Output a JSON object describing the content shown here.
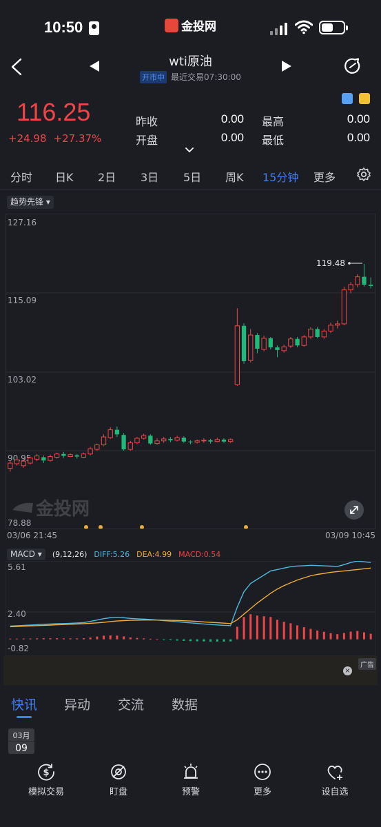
{
  "status_bar": {
    "time": "10:50",
    "logo_text": "金投网"
  },
  "header": {
    "title": "wti原油",
    "market_status": "开市中",
    "last_trade": "最近交易07:30:00"
  },
  "quote": {
    "price": "116.25",
    "change": "+24.98",
    "change_pct": "+27.37%",
    "prev_close_label": "昨收",
    "prev_close": "0.00",
    "high_label": "最高",
    "high": "0.00",
    "open_label": "开盘",
    "open": "0.00",
    "low_label": "最低",
    "low": "0.00",
    "up_color": "#ef4548",
    "down_color": "#1fb97a"
  },
  "period_tabs": [
    {
      "label": "分时"
    },
    {
      "label": "日K"
    },
    {
      "label": "2日"
    },
    {
      "label": "3日"
    },
    {
      "label": "5日"
    },
    {
      "label": "周K"
    },
    {
      "label": "15分钟",
      "active": true
    },
    {
      "label": "更多"
    }
  ],
  "indicator_select": "趋势先锋",
  "chart_data": {
    "type": "candlestick",
    "y_ticks": [
      "127.16",
      "115.09",
      "103.02",
      "90.95",
      "78.88"
    ],
    "ylim": [
      78.88,
      127.16
    ],
    "x_start_label": "03/06 21:45",
    "x_end_label": "03/09 10:45",
    "max_marker": "119.48",
    "watermark": "金投网",
    "candles": [
      [
        88.2,
        89.0,
        87.7,
        89.4
      ],
      [
        88.9,
        89.5,
        88.6,
        89.8
      ],
      [
        88.6,
        89.3,
        88.3,
        89.6
      ],
      [
        89.0,
        89.8,
        88.8,
        90.0
      ],
      [
        89.6,
        90.1,
        89.3,
        90.4
      ],
      [
        89.9,
        89.4,
        89.0,
        90.2
      ],
      [
        89.4,
        90.0,
        89.2,
        90.3
      ],
      [
        89.9,
        90.4,
        89.7,
        90.6
      ],
      [
        90.4,
        90.1,
        89.8,
        90.7
      ],
      [
        90.0,
        90.3,
        89.9,
        90.5
      ],
      [
        90.2,
        90.0,
        89.7,
        90.4
      ],
      [
        89.9,
        90.4,
        89.8,
        90.6
      ],
      [
        90.4,
        91.2,
        90.2,
        91.5
      ],
      [
        91.1,
        91.8,
        90.9,
        92.0
      ],
      [
        91.8,
        93.0,
        91.6,
        93.4
      ],
      [
        92.9,
        94.1,
        92.7,
        94.5
      ],
      [
        94.1,
        93.4,
        93.0,
        94.6
      ],
      [
        93.3,
        91.1,
        90.9,
        93.6
      ],
      [
        91.1,
        92.1,
        90.9,
        92.4
      ],
      [
        92.1,
        92.8,
        91.9,
        93.0
      ],
      [
        92.8,
        93.2,
        92.6,
        93.5
      ],
      [
        93.2,
        92.0,
        91.8,
        93.4
      ],
      [
        92.0,
        92.4,
        91.8,
        92.8
      ],
      [
        92.4,
        92.7,
        92.1,
        93.0
      ],
      [
        92.7,
        92.5,
        92.2,
        93.0
      ],
      [
        92.5,
        92.9,
        92.3,
        93.2
      ],
      [
        92.9,
        92.3,
        92.1,
        93.1
      ],
      [
        92.3,
        92.2,
        91.9,
        92.5
      ],
      [
        92.2,
        92.4,
        92.0,
        92.6
      ],
      [
        92.4,
        92.5,
        92.1,
        92.8
      ],
      [
        92.5,
        92.3,
        92.0,
        92.7
      ],
      [
        92.3,
        92.6,
        92.2,
        92.9
      ],
      [
        92.6,
        92.3,
        92.1,
        92.8
      ],
      [
        92.3,
        92.6,
        92.1,
        92.8
      ],
      [
        101.0,
        110.0,
        100.8,
        112.7
      ],
      [
        110.0,
        104.6,
        104.2,
        110.4
      ],
      [
        104.7,
        108.6,
        104.4,
        109.5
      ],
      [
        108.6,
        106.5,
        105.8,
        108.9
      ],
      [
        106.4,
        108.1,
        106.1,
        108.5
      ],
      [
        108.1,
        106.7,
        106.4,
        108.3
      ],
      [
        106.7,
        106.3,
        105.2,
        107.0
      ],
      [
        106.2,
        106.8,
        105.9,
        107.1
      ],
      [
        106.9,
        108.0,
        106.6,
        108.3
      ],
      [
        108.0,
        107.0,
        106.7,
        108.3
      ],
      [
        107.0,
        108.3,
        106.8,
        108.6
      ],
      [
        108.3,
        109.5,
        108.0,
        109.8
      ],
      [
        109.5,
        108.3,
        108.1,
        109.8
      ],
      [
        108.3,
        109.2,
        108.0,
        109.5
      ],
      [
        109.2,
        110.1,
        108.9,
        110.5
      ],
      [
        110.1,
        110.3,
        109.6,
        110.8
      ],
      [
        110.3,
        115.5,
        110.1,
        116.0
      ],
      [
        115.5,
        116.3,
        115.0,
        116.7
      ],
      [
        116.3,
        117.5,
        115.9,
        117.9
      ],
      [
        117.5,
        116.3,
        116.0,
        119.48
      ],
      [
        116.3,
        116.1,
        115.7,
        117.4
      ]
    ]
  },
  "macd": {
    "label": "MACD",
    "params": "(9,12,26)",
    "diff_label": "DIFF:5.26",
    "dea_label": "DEA:4.99",
    "macd_label": "MACD:0.54",
    "y_ticks": [
      "5.61",
      "2.40",
      "-0.82"
    ],
    "ylim": [
      -1.2,
      5.61
    ],
    "diff_color": "#4fb8dd",
    "dea_color": "#f0ad3b",
    "diff": [
      0.95,
      0.97,
      1.0,
      1.02,
      1.05,
      1.08,
      1.1,
      1.12,
      1.13,
      1.15,
      1.17,
      1.2,
      1.28,
      1.38,
      1.48,
      1.55,
      1.58,
      1.55,
      1.5,
      1.47,
      1.45,
      1.42,
      1.38,
      1.34,
      1.3,
      1.26,
      1.22,
      1.18,
      1.14,
      1.1,
      1.06,
      1.03,
      1.0,
      0.98,
      2.3,
      3.4,
      4.0,
      4.3,
      4.6,
      4.9,
      5.0,
      5.1,
      5.2,
      5.25,
      5.27,
      5.3,
      5.28,
      5.26,
      5.24,
      5.22,
      5.35,
      5.5,
      5.6,
      5.55,
      5.5
    ],
    "dea": [
      0.9,
      0.92,
      0.94,
      0.96,
      0.98,
      1.0,
      1.02,
      1.04,
      1.06,
      1.08,
      1.1,
      1.12,
      1.15,
      1.18,
      1.22,
      1.27,
      1.31,
      1.34,
      1.36,
      1.37,
      1.38,
      1.38,
      1.38,
      1.37,
      1.36,
      1.35,
      1.33,
      1.31,
      1.28,
      1.25,
      1.22,
      1.19,
      1.16,
      1.13,
      1.4,
      1.8,
      2.2,
      2.6,
      2.95,
      3.3,
      3.6,
      3.85,
      4.05,
      4.25,
      4.4,
      4.55,
      4.65,
      4.72,
      4.8,
      4.85,
      4.9,
      4.95,
      5.0,
      5.05,
      5.1
    ],
    "hist": [
      0.05,
      0.05,
      0.06,
      0.06,
      0.07,
      0.08,
      0.08,
      0.08,
      0.07,
      0.07,
      0.07,
      0.08,
      0.13,
      0.2,
      0.26,
      0.28,
      0.27,
      0.21,
      0.14,
      0.1,
      0.07,
      0.04,
      0.0,
      -0.03,
      -0.06,
      -0.09,
      -0.11,
      -0.13,
      -0.14,
      -0.15,
      -0.16,
      -0.16,
      -0.16,
      -0.15,
      0.9,
      1.6,
      1.8,
      1.7,
      1.65,
      1.6,
      1.4,
      1.25,
      1.15,
      1.0,
      0.87,
      0.75,
      0.63,
      0.54,
      0.44,
      0.37,
      0.45,
      0.55,
      0.6,
      0.5,
      0.4
    ]
  },
  "ad": {
    "label": "广告"
  },
  "news_tabs": [
    {
      "label": "快讯",
      "active": true
    },
    {
      "label": "异动"
    },
    {
      "label": "交流"
    },
    {
      "label": "数据"
    }
  ],
  "date_chip": {
    "month": "03月",
    "day": "09"
  },
  "bottom_nav": [
    {
      "label": "模拟交易",
      "icon": "dollar-cycle-icon"
    },
    {
      "label": "盯盘",
      "icon": "eye-off-icon"
    },
    {
      "label": "预警",
      "icon": "alarm-icon"
    },
    {
      "label": "更多",
      "icon": "more-icon"
    },
    {
      "label": "设自选",
      "icon": "heart-plus-icon"
    }
  ]
}
